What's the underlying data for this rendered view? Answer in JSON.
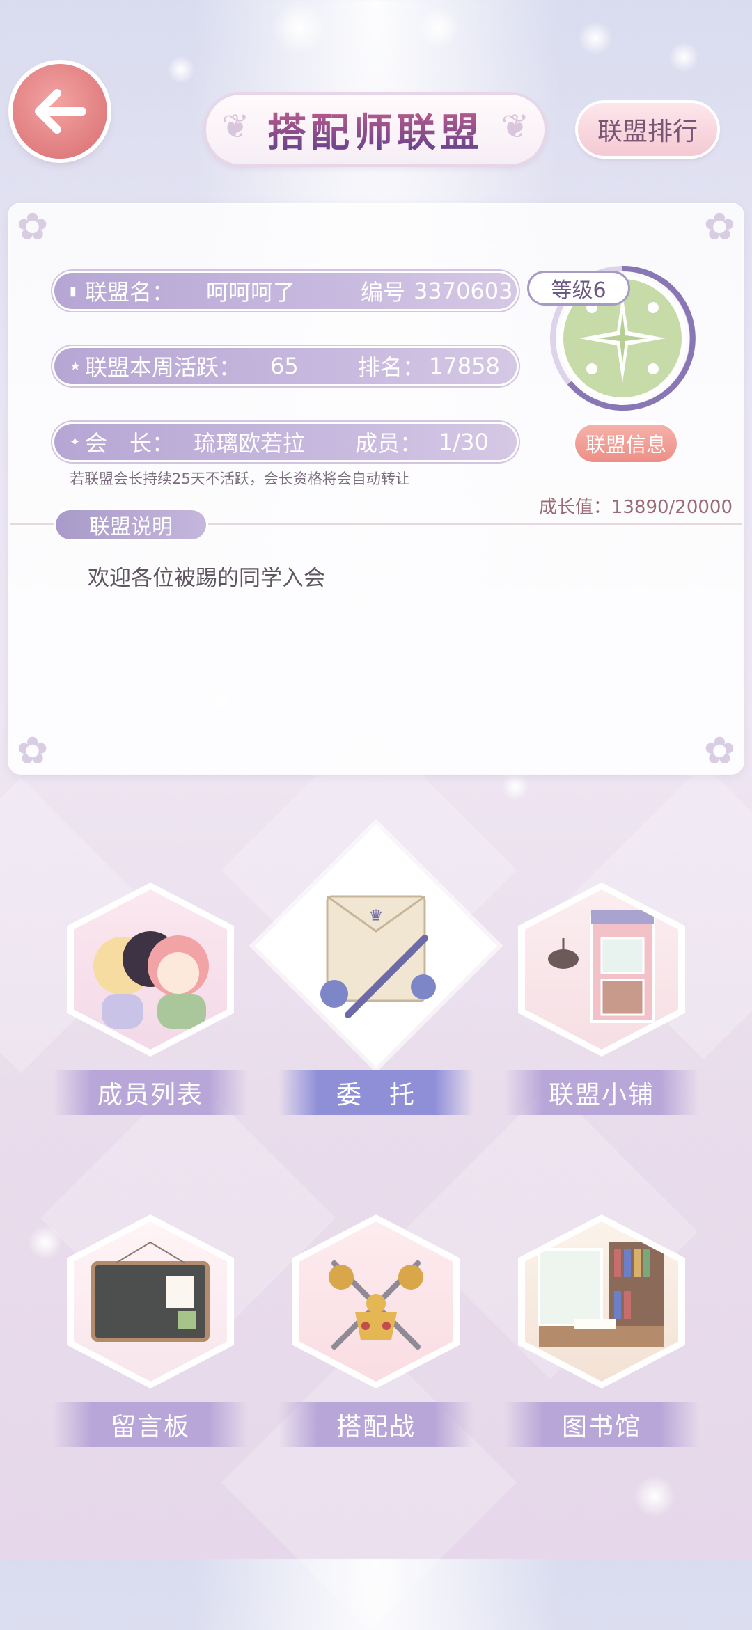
{
  "header": {
    "title": "搭配师联盟",
    "rank_button": "联盟排行"
  },
  "alliance": {
    "name_label": "联盟名：",
    "name": "呵呵呵了",
    "id_label": "编号",
    "id": "3370603",
    "weekly_label": "联盟本周活跃：",
    "weekly_value": "65",
    "rank_label": "排名：",
    "rank_value": "17858",
    "leader_label": "会　长：",
    "leader": "琉璃欧若拉",
    "members_label": "成员：",
    "members": "1/30",
    "level": "等级6",
    "info_button": "联盟信息",
    "hint": "若联盟会长持续25天不活跃，会长资格将会自动转让",
    "growth": "成长值：13890/20000",
    "desc_tag": "联盟说明",
    "desc": "欢迎各位被踢的同学入会"
  },
  "menu": {
    "members": "成员列表",
    "commission": "委　托",
    "shop": "联盟小铺",
    "board": "留言板",
    "battle": "搭配战",
    "library": "图书馆"
  },
  "icons": {
    "back": "back-arrow-icon",
    "star": "star-icon",
    "book": "book-icon",
    "badge": "compass-star-icon"
  },
  "colors": {
    "accent": "#b6a6d4",
    "back_button": "#e07d7f",
    "info_button": "#ec8f86",
    "title_grad_top": "#c9608a",
    "title_grad_bottom": "#5b3f8c"
  }
}
